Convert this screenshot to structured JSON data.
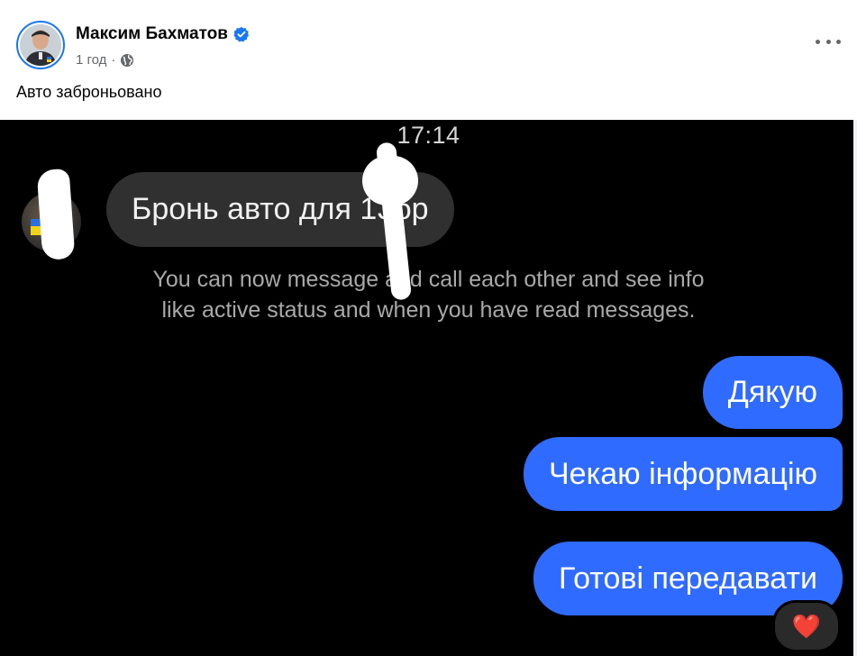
{
  "post": {
    "author_name": "Максим Бахматов",
    "time_label": "1 год",
    "separator": "·",
    "text": "Авто заброньовано",
    "verified_color": "#1877f2"
  },
  "chat": {
    "time": "17:14",
    "incoming_message": "Бронь авто для 13бр",
    "system_note_line1": "You can now message and call each other and see info",
    "system_note_line2": "like active status and when you have read messages.",
    "outgoing": [
      {
        "text": "Дякую"
      },
      {
        "text": "Чекаю інформацію"
      },
      {
        "text": "Готові передавати"
      }
    ],
    "reaction": "❤️",
    "bubble_color": "#2f6bff"
  },
  "icons": {
    "verified": "verified-badge-icon",
    "globe": "globe-icon",
    "more": "more-options-icon"
  }
}
